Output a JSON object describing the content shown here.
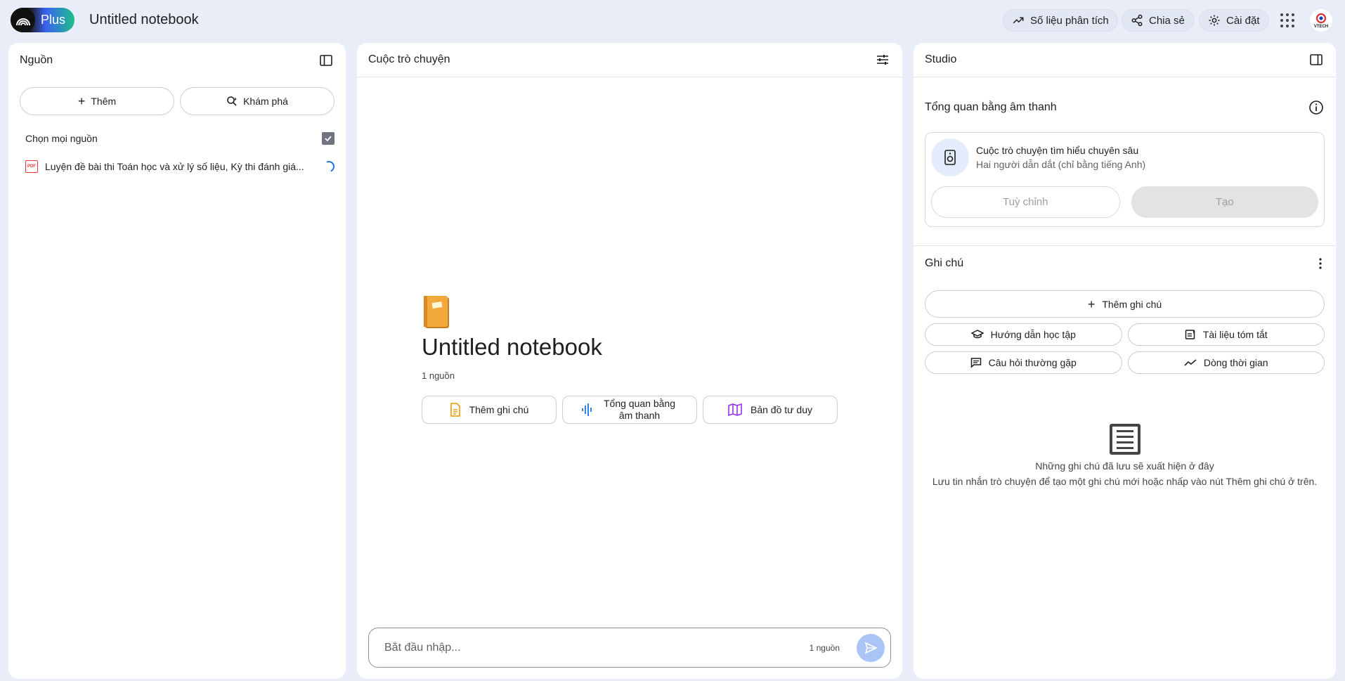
{
  "header": {
    "brand": "Plus",
    "notebook_title": "Untitled notebook",
    "analytics_label": "Số liệu phân tích",
    "share_label": "Chia sẻ",
    "settings_label": "Cài đặt",
    "avatar_text": "VTECH"
  },
  "sources": {
    "title": "Nguồn",
    "add_label": "Thêm",
    "discover_label": "Khám phá",
    "select_all_label": "Chọn mọi nguồn",
    "items": [
      {
        "name": "Luyện đề bài thi Toán học và xử lý số liệu, Kỳ thi đánh giá...",
        "type": "PDF"
      }
    ]
  },
  "chat": {
    "title": "Cuộc trò chuyện",
    "notebook_title": "Untitled notebook",
    "source_count": "1 nguồn",
    "actions": {
      "add_note": "Thêm ghi chú",
      "audio_overview": "Tổng quan bằng âm thanh",
      "mind_map": "Bản đồ tư duy"
    },
    "input_placeholder": "Bắt đầu nhập...",
    "input_source_count": "1 nguồn"
  },
  "studio": {
    "title": "Studio",
    "audio_section_title": "Tổng quan bằng âm thanh",
    "audio_card_title": "Cuộc trò chuyện tìm hiểu chuyên sâu",
    "audio_card_subtitle": "Hai người dẫn dắt (chỉ bằng tiếng Anh)",
    "customize_label": "Tuỳ chỉnh",
    "create_label": "Tạo",
    "notes_title": "Ghi chú",
    "add_note_label": "Thêm ghi chú",
    "study_guide_label": "Hướng dẫn học tập",
    "briefing_doc_label": "Tài liệu tóm tắt",
    "faq_label": "Câu hỏi thường gặp",
    "timeline_label": "Dòng thời gian",
    "empty_title": "Những ghi chú đã lưu sẽ xuất hiện ở đây",
    "empty_desc": "Lưu tin nhắn trò chuyện để tạo một ghi chú mới hoặc nhấp vào nút Thêm ghi chú ở trên."
  }
}
